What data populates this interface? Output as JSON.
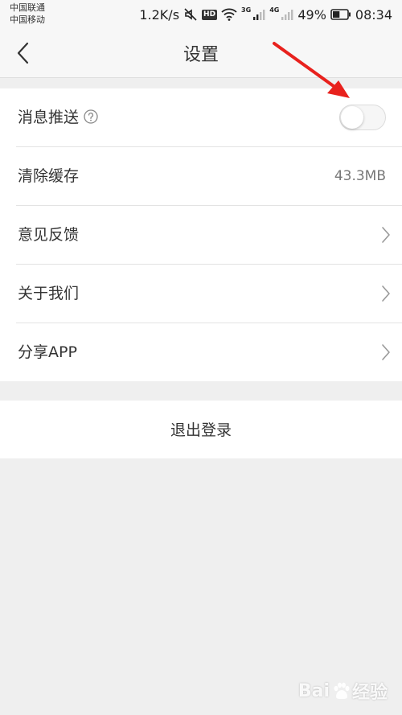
{
  "status_bar": {
    "carrier_1": "中国联通",
    "carrier_2": "中国移动",
    "net_speed": "1.2K/s",
    "hd_badge": "HD",
    "net_3g": "3G",
    "net_4g": "4G",
    "battery": "49%",
    "time": "08:34",
    "battery_level": 0.49
  },
  "header": {
    "title": "设置",
    "back_icon": "chevron-left-icon"
  },
  "settings": {
    "items": [
      {
        "label": "消息推送",
        "type": "toggle",
        "enabled": false,
        "icon": "help-icon"
      },
      {
        "label": "清除缓存",
        "type": "value",
        "value": "43.3MB"
      },
      {
        "label": "意见反馈",
        "type": "link",
        "icon": "chevron-right-icon"
      },
      {
        "label": "关于我们",
        "type": "link",
        "icon": "chevron-right-icon"
      },
      {
        "label": "分享APP",
        "type": "link",
        "icon": "chevron-right-icon"
      }
    ]
  },
  "logout": {
    "label": "退出登录"
  },
  "watermark": {
    "prefix": "Bai",
    "suffix": "经验"
  },
  "colors": {
    "annotation_arrow": "#e8211d",
    "background": "#efefef",
    "surface": "#ffffff"
  }
}
